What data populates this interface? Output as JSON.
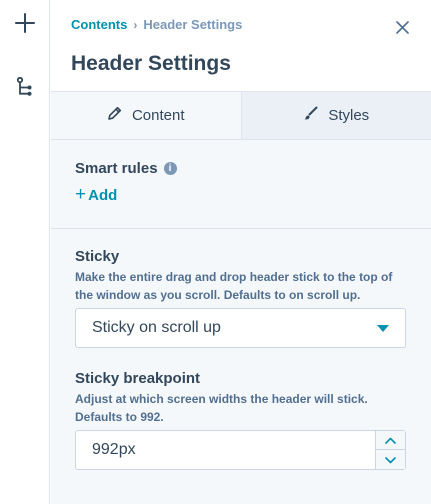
{
  "rail": {
    "add_icon": "plus-icon",
    "tree_icon": "tree-structure-icon"
  },
  "header": {
    "breadcrumb_parent": "Contents",
    "breadcrumb_separator": "›",
    "breadcrumb_current": "Header Settings",
    "title": "Header Settings",
    "close_icon": "close-icon"
  },
  "tabs": [
    {
      "label": "Content",
      "icon": "pencil-icon",
      "active": true
    },
    {
      "label": "Styles",
      "icon": "brush-icon",
      "active": false
    }
  ],
  "smart_rules": {
    "label": "Smart rules",
    "info_glyph": "i",
    "add_plus": "+",
    "add_label": "Add"
  },
  "sticky": {
    "label": "Sticky",
    "help": "Make the entire drag and drop header stick to the top of the window as you scroll. Defaults to on scroll up.",
    "selected": "Sticky on scroll up"
  },
  "breakpoint": {
    "label": "Sticky breakpoint",
    "help": "Adjust at which screen widths the header will stick. Defaults to 992.",
    "value": "992px"
  },
  "colors": {
    "accent": "#0091ae",
    "text": "#33475b",
    "muted": "#516f90",
    "panel_bg": "#f5f8fa",
    "tab_inactive_bg": "#eaf0f6",
    "border": "#cbd6e2"
  }
}
